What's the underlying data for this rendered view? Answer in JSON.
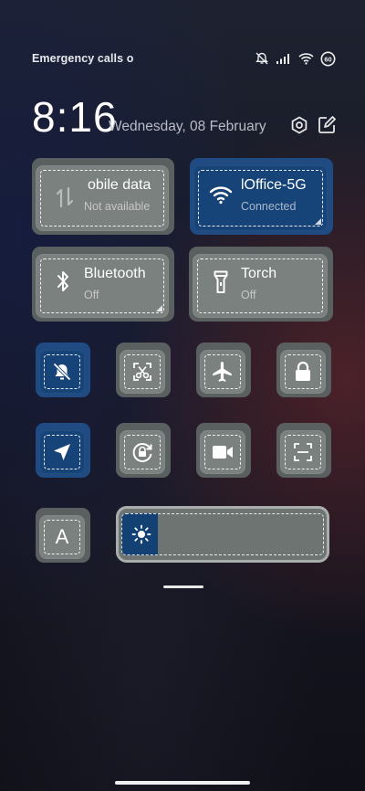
{
  "status_bar": {
    "carrier_text": "Emergency calls o",
    "icons": [
      "silent-icon",
      "signal-icon",
      "wifi-icon",
      "battery-icon"
    ],
    "battery_level": "60"
  },
  "header": {
    "time": "8:16",
    "date": "Wednesday, 08 February",
    "settings_icon": "gear-icon",
    "edit_icon": "edit-icon"
  },
  "tiles": {
    "mobile_data": {
      "label": "obile data",
      "status": "Not available",
      "active": false
    },
    "wifi": {
      "label": "lOffice-5G",
      "status": "Connected",
      "active": true
    },
    "bluetooth": {
      "label": "Bluetooth",
      "status": "Off",
      "active": false
    },
    "torch": {
      "label": "Torch",
      "status": "Off",
      "active": false
    }
  },
  "toggles": [
    {
      "name": "silent-toggle",
      "icon": "bell-off-icon",
      "active": true
    },
    {
      "name": "screenshot-toggle",
      "icon": "scissors-icon",
      "active": false
    },
    {
      "name": "airplane-toggle",
      "icon": "airplane-icon",
      "active": false
    },
    {
      "name": "lock-toggle",
      "icon": "lock-icon",
      "active": false
    },
    {
      "name": "location-toggle",
      "icon": "location-icon",
      "active": true
    },
    {
      "name": "rotation-toggle",
      "icon": "rotation-lock-icon",
      "active": false
    },
    {
      "name": "screen-record-toggle",
      "icon": "video-camera-icon",
      "active": false
    },
    {
      "name": "scanner-toggle",
      "icon": "scan-icon",
      "active": false
    }
  ],
  "auto_brightness": {
    "label": "A"
  },
  "brightness": {
    "level": 0.12,
    "icon": "sun-icon"
  },
  "colors": {
    "active_tile": "#174478",
    "inactive_tile": "#7b817f"
  }
}
